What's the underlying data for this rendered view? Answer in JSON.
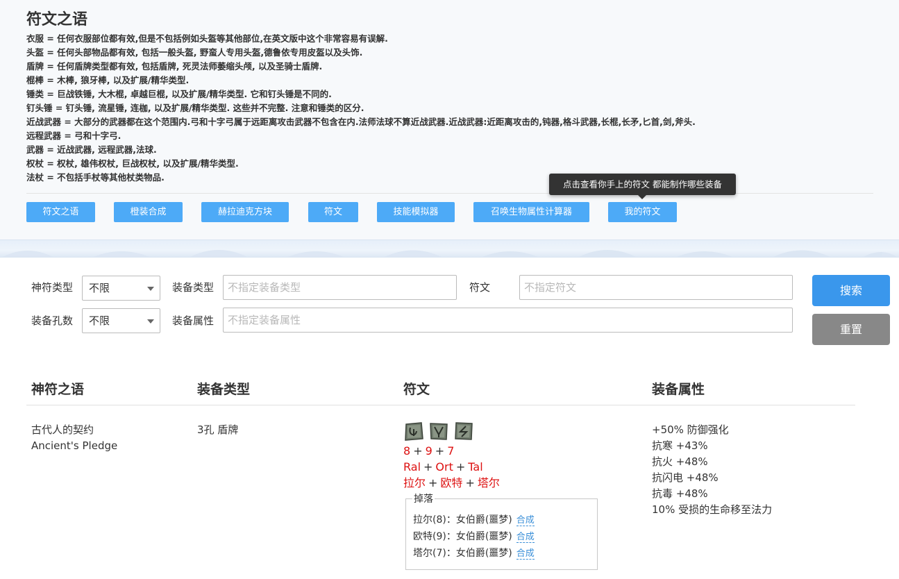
{
  "header": {
    "title": "符文之语",
    "definitions": [
      "衣服 = 任何衣服部位都有效,但是不包括例如头盔等其他部位,在英文版中这个非常容易有误解.",
      "头盔 = 任何头部物品都有效, 包括一般头盔, 野蛮人专用头盔,德鲁依专用皮盔以及头饰.",
      "盾牌 = 任何盾牌类型都有效, 包括盾牌, 死灵法师萎缩头颅, 以及圣骑士盾牌.",
      "棍棒 = 木棒, 狼牙棒, 以及扩展/精华类型.",
      "锤类 = 巨战铁锤, 大木棍, 卓越巨棍, 以及扩展/精华类型. 它和钉头锤是不同的.",
      "钉头锤 = 钉头锤, 流星锤, 连枷, 以及扩展/精华类型. 这些并不完整. 注意和锤类的区分.",
      "近战武器 = 大部分的武器都在这个范围内.弓和十字弓属于远距离攻击武器不包含在内.法师法球不算近战武器.近战武器:近距离攻击的,钝器,格斗武器,长棍,长矛,匕首,剑,斧头.",
      "远程武器 = 弓和十字弓.",
      "武器 = 近战武器, 远程武器,法球.",
      "权杖 = 权杖, 雄伟权杖, 巨战权杖, 以及扩展/精华类型.",
      "法杖 = 不包括手杖等其他杖类物品."
    ]
  },
  "nav": {
    "buttons": [
      "符文之语",
      "橙装合成",
      "赫拉迪克方块",
      "符文",
      "技能模拟器",
      "召唤生物属性计算器",
      "我的符文"
    ],
    "tooltip": "点击查看你手上的符文 都能制作哪些装备"
  },
  "search": {
    "rune_type_label": "神符类型",
    "rune_type_value": "不限",
    "equip_type_label": "装备类型",
    "equip_type_placeholder": "不指定装备类型",
    "rune_label": "符文",
    "rune_placeholder": "不指定符文",
    "sockets_label": "装备孔数",
    "sockets_value": "不限",
    "equip_prop_label": "装备属性",
    "equip_prop_placeholder": "不指定装备属性",
    "search_button": "搜索",
    "reset_button": "重置"
  },
  "table": {
    "headers": [
      "神符之语",
      "装备类型",
      "符文",
      "装备属性"
    ],
    "rows": [
      {
        "name_cn": "古代人的契约",
        "name_en": "Ancient's Pledge",
        "equip_type": "3孔 盾牌",
        "rune_numbers": [
          "8",
          "9",
          "7"
        ],
        "rune_names_en": [
          "Ral",
          "Ort",
          "Tal"
        ],
        "rune_names_cn": [
          "拉尔",
          "欧特",
          "塔尔"
        ],
        "rune_icons": [
          "rune-ral-icon",
          "rune-ort-icon",
          "rune-tal-icon"
        ],
        "drop_title": "掉落",
        "drops": [
          {
            "text": "拉尔(8)：女伯爵(噩梦)",
            "link": "合成"
          },
          {
            "text": "欧特(9)：女伯爵(噩梦)",
            "link": "合成"
          },
          {
            "text": "塔尔(7)：女伯爵(噩梦)",
            "link": "合成"
          }
        ],
        "properties": [
          "+50% 防御强化",
          "抗寒 +43%",
          "抗火 +48%",
          "抗闪电 +48%",
          "抗毒 +48%",
          "10% 受损的生命移至法力"
        ]
      }
    ]
  },
  "colors": {
    "nav_button": "#4daaf7",
    "search_button": "#3a97ec",
    "reset_button": "#888888",
    "rune_text": "#dd1111",
    "link": "#3a8fd8"
  }
}
